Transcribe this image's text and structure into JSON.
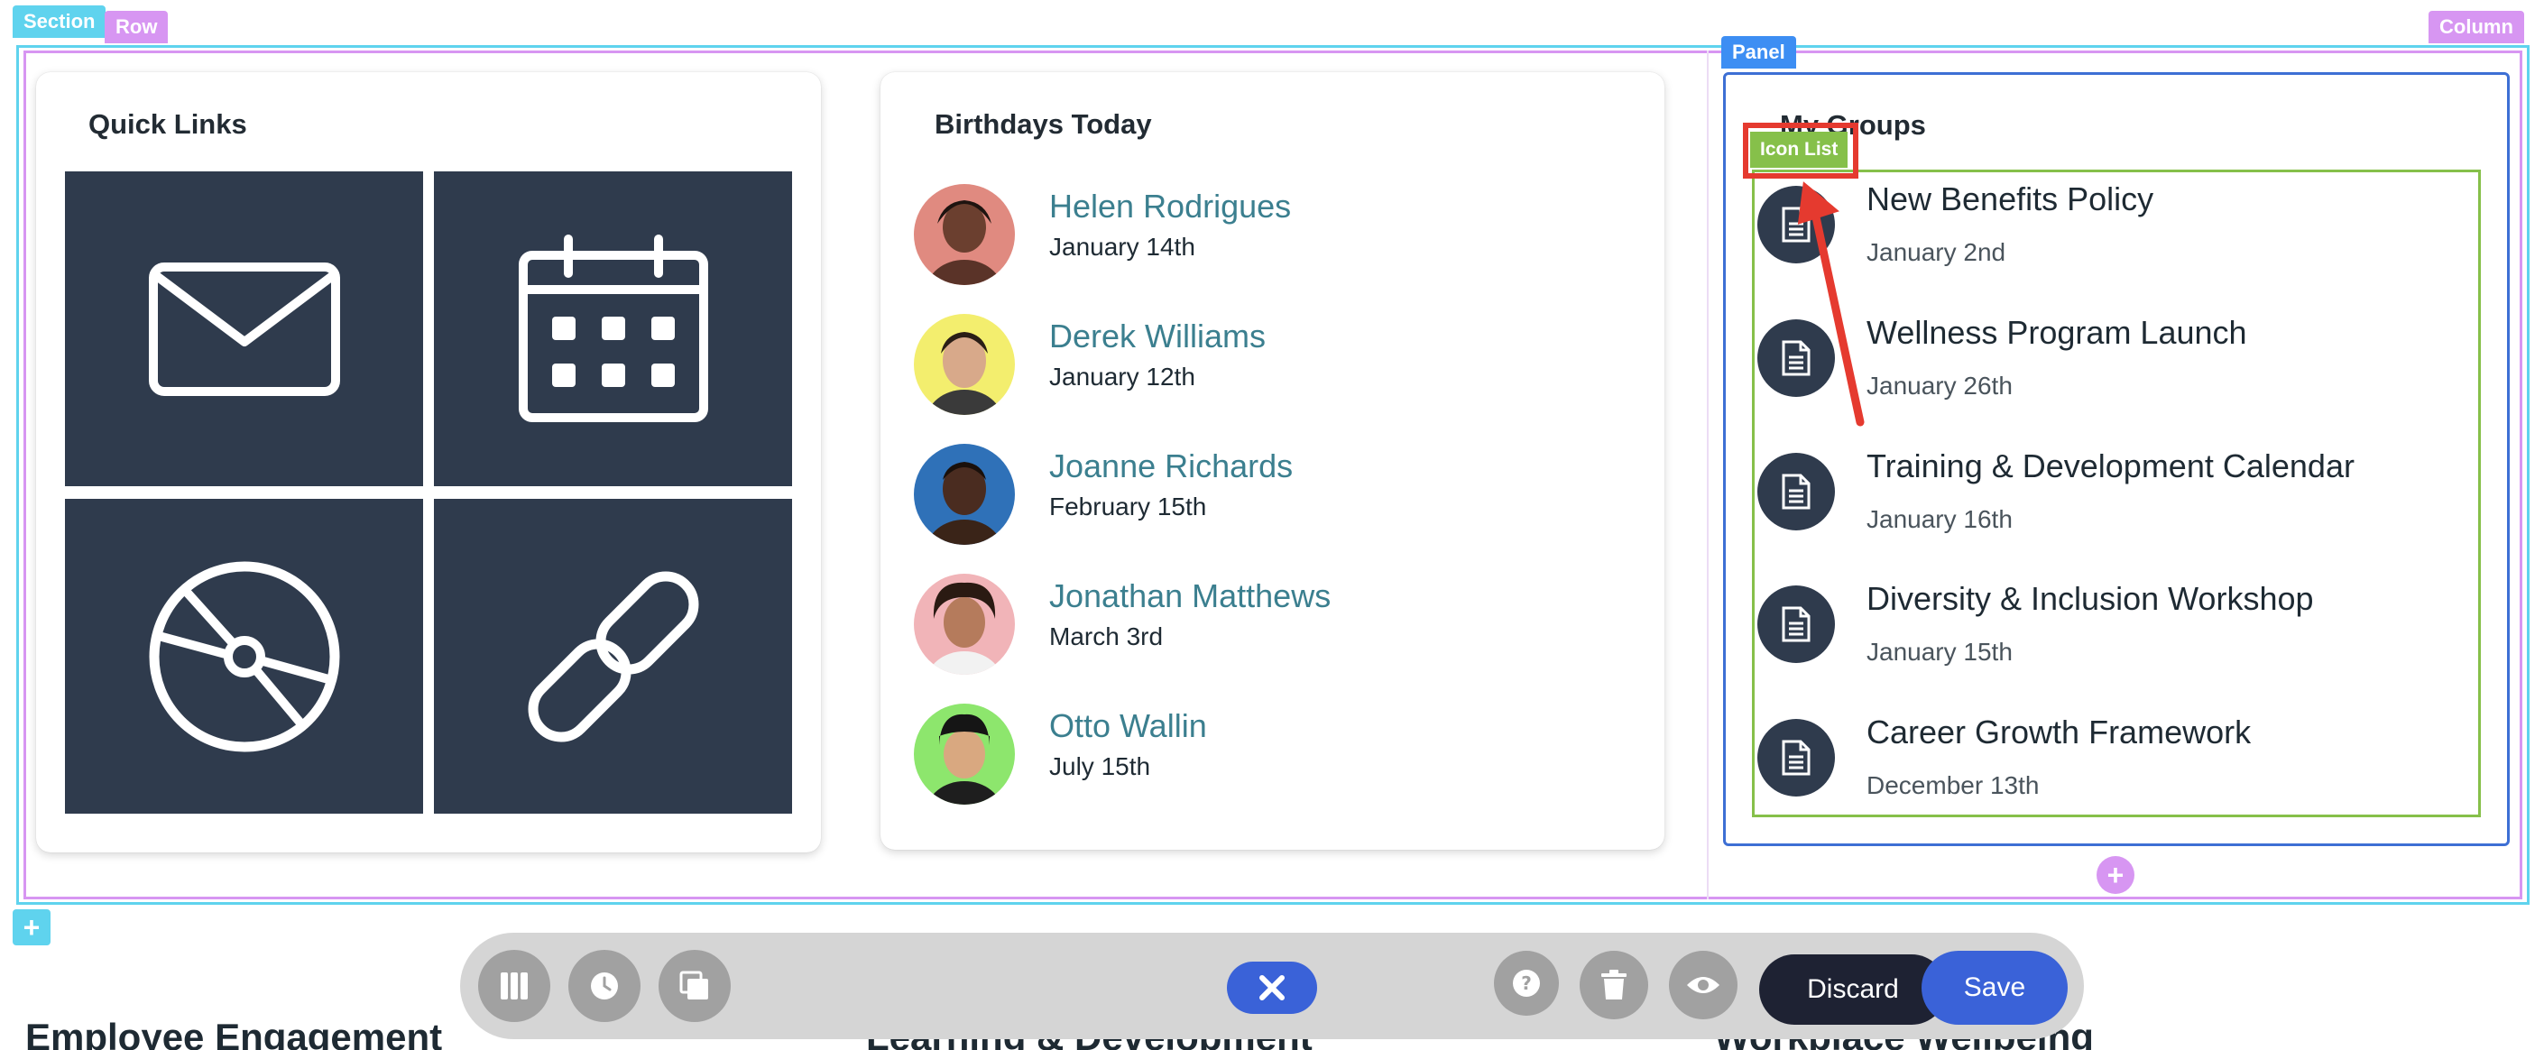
{
  "builder": {
    "section_tag": "Section",
    "row_tag": "Row",
    "column_tag": "Column",
    "panel_tag": "Panel",
    "icon_list_tag": "Icon List",
    "add_symbol": "+"
  },
  "quick_links": {
    "title": "Quick Links",
    "tiles": [
      {
        "icon": "mail-icon"
      },
      {
        "icon": "calendar-icon"
      },
      {
        "icon": "disc-icon"
      },
      {
        "icon": "link-icon"
      }
    ]
  },
  "birthdays": {
    "title": "Birthdays Today",
    "people": [
      {
        "name": "Helen Rodrigues",
        "date": "January 14th",
        "avatar_bg": "#e08a80"
      },
      {
        "name": "Derek Williams",
        "date": "January 12th",
        "avatar_bg": "#f3ee6e"
      },
      {
        "name": "Joanne Richards",
        "date": "February 15th",
        "avatar_bg": "#2f71b8"
      },
      {
        "name": "Jonathan Matthews",
        "date": "March 3rd",
        "avatar_bg": "#f1b4b8"
      },
      {
        "name": "Otto Wallin",
        "date": "July 15th",
        "avatar_bg": "#8de66d"
      }
    ]
  },
  "groups": {
    "title": "My Groups",
    "items": [
      {
        "title": "New Benefits Policy",
        "date": "January 2nd"
      },
      {
        "title": "Wellness Program Launch",
        "date": "January 26th"
      },
      {
        "title": "Training & Development Calendar",
        "date": "January 16th"
      },
      {
        "title": "Diversity & Inclusion Workshop",
        "date": "January 15th"
      },
      {
        "title": "Career Growth Framework",
        "date": "December 13th"
      }
    ]
  },
  "below_sections": {
    "left": "Employee Engagement",
    "middle": "Learning & Development",
    "right": "Workplace Wellbeing"
  },
  "toolbar": {
    "discard_label": "Discard",
    "save_label": "Save"
  },
  "colors": {
    "tile": "#2f3b4d",
    "accent_link": "#3b7f8f",
    "save": "#3a62d8",
    "discard": "#1e2233",
    "section_outline": "#5fd3ee",
    "row_outline": "#d796f2",
    "panel_outline": "#3d6fd4",
    "icon_list_outline": "#86c04a",
    "highlight": "#e53a2f"
  }
}
